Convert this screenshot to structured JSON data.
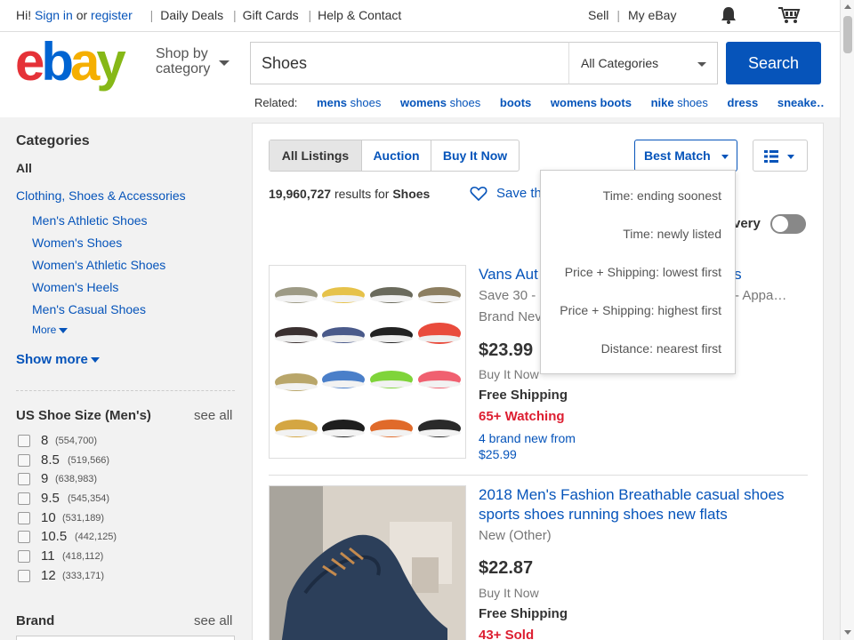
{
  "topbar": {
    "greeting": "Hi! ",
    "sign_in": "Sign in",
    "or": " or ",
    "register": "register",
    "daily_deals": "Daily Deals",
    "gift_cards": "Gift Cards",
    "help_contact": "Help & Contact",
    "sell": "Sell",
    "my_ebay": "My eBay",
    "notifications_icon": "bell-icon",
    "cart_icon": "cart-icon"
  },
  "header": {
    "logo": {
      "e": "e",
      "b": "b",
      "a": "a",
      "y": "y"
    },
    "shop_by_line1": "Shop by",
    "shop_by_line2": "category",
    "search_value": "Shoes",
    "category_select": "All Categories",
    "search_button": "Search"
  },
  "related": {
    "label": "Related:",
    "items": [
      {
        "bold": "mens",
        "light": " shoes"
      },
      {
        "bold": "womens",
        "light": " shoes"
      },
      {
        "bold": "boots",
        "light": ""
      },
      {
        "bold": "womens boots",
        "light": ""
      },
      {
        "bold": "nike",
        "light": " shoes"
      },
      {
        "bold": "dress",
        "light": ""
      },
      {
        "bold": "sneake…",
        "light": ""
      }
    ]
  },
  "sidebar": {
    "categories_title": "Categories",
    "all": "All",
    "category": "Clothing, Shoes & Accessories",
    "subcategories": [
      "Men's Athletic Shoes",
      "Women's Shoes",
      "Women's Athletic Shoes",
      "Women's Heels",
      "Men's Casual Shoes"
    ],
    "more": "More",
    "show_more": "Show more",
    "size_title": "US Shoe Size (Men's)",
    "see_all": "see all",
    "sizes": [
      {
        "size": "8",
        "count": "(554,700)"
      },
      {
        "size": "8.5",
        "count": "(519,566)"
      },
      {
        "size": "9",
        "count": "(638,983)"
      },
      {
        "size": "9.5",
        "count": "(545,354)"
      },
      {
        "size": "10",
        "count": "(531,189)"
      },
      {
        "size": "10.5",
        "count": "(442,125)"
      },
      {
        "size": "11",
        "count": "(418,112)"
      },
      {
        "size": "12",
        "count": "(333,171)"
      }
    ],
    "brand_title": "Brand",
    "brand_see_all": "see all"
  },
  "main": {
    "tabs": [
      "All Listings",
      "Auction",
      "Buy It Now"
    ],
    "sort_label": "Best Match",
    "results_count": "19,960,727",
    "results_for": " results for ",
    "results_query": "Shoes",
    "save_search": "Save th",
    "delivery_fragment": "very",
    "items": [
      {
        "title_a": "Vans Aut",
        "title_b": "ers",
        "sub_a": "Save 30 -",
        "sub_b": "ls - Appa…",
        "condition": "Brand Nev",
        "price": "$23.99",
        "format": "Buy It Now",
        "shipping": "Free Shipping",
        "watching": "65+ Watching",
        "from_line1": "4 brand new from",
        "from_line2": "$25.99"
      },
      {
        "title_line1": "2018 Men's Fashion Breathable casual shoes",
        "title_line2": "sports shoes running shoes new flats",
        "condition": "New (Other)",
        "price": "$22.87",
        "format": "Buy It Now",
        "shipping": "Free Shipping",
        "sold": "43+ Sold"
      }
    ]
  },
  "sort_menu": [
    "Time: ending soonest",
    "Time: newly listed",
    "Price + Shipping: lowest first",
    "Price + Shipping: highest first",
    "Distance: nearest first"
  ],
  "colors": {
    "link": "#0654ba",
    "watching": "#dd1e31",
    "logo_e": "#e53238",
    "logo_b": "#0064d2",
    "logo_a": "#f5af02",
    "logo_y": "#86b817"
  }
}
